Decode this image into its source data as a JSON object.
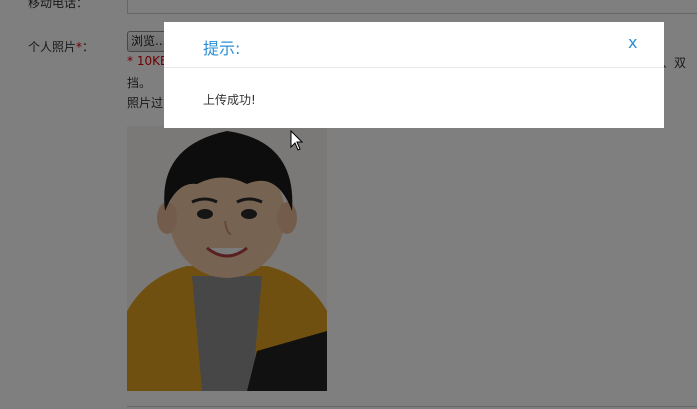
{
  "form": {
    "mobile_label": "移动电话：",
    "photo_label": "个人照片",
    "required_mark": "*",
    "colon": "：",
    "browse_label": "浏览...",
    "note_red": "* 10KB",
    "note_right_fragment": "毛、双",
    "note_line2": "挡。",
    "note_line3": "照片过"
  },
  "dialog": {
    "title": "提示:",
    "close_label": "x",
    "message": "上传成功!"
  },
  "colors": {
    "accent": "#2a8fd6",
    "required": "#dd0000",
    "overlay": "rgba(0,0,0,0.5)"
  }
}
